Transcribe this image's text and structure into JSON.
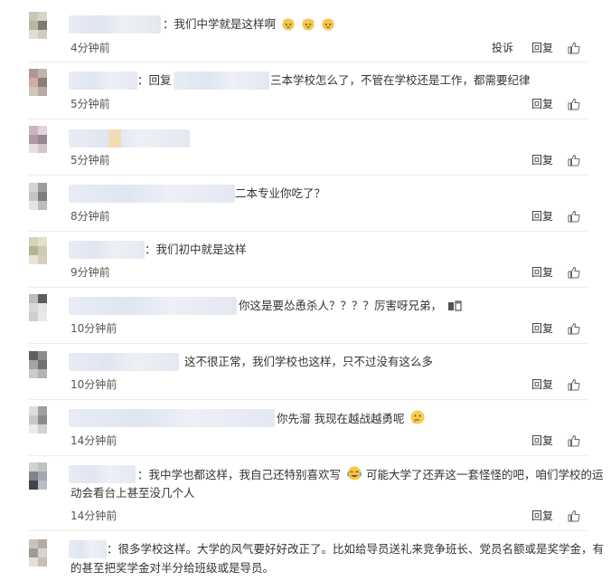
{
  "labels": {
    "report": "投诉",
    "reply": "回复"
  },
  "icons": {
    "like": "thumbs-up-icon",
    "emoji_cat": "cat-face-emoji",
    "emoji_laugh": "laugh-cry-emoji",
    "emoji_think": "thinking-emoji",
    "emoji_beer": "beer-emoji"
  },
  "comments": [
    {
      "text": "：我们中学就是这样啊",
      "time": "4分钟前",
      "emoji": "cat",
      "report": true
    },
    {
      "text": "：回复",
      "text2": "三本学校怎么了，不管在学校还是工作，都需要纪律",
      "time": "5分钟前"
    },
    {
      "text": "",
      "time": "5分钟前"
    },
    {
      "text": "二本专业你吃了？",
      "time": "8分钟前"
    },
    {
      "text": "：我们初中就是这样",
      "time": "9分钟前"
    },
    {
      "text": "你这是要怂恿杀人？？？？厉害呀兄弟，",
      "time": "10分钟前"
    },
    {
      "text": "这不很正常，我们学校也这样，只不过没有这么多",
      "time": "10分钟前"
    },
    {
      "text": "你先溜 我现在越战越勇呢",
      "time": "14分钟前"
    },
    {
      "text": "：我中学也都这样，我自己还特别喜欢写",
      "text2": "可能大学了还弄这一套怪怪的吧，咱们学校的运",
      "text3": "动会看台上甚至没几个人",
      "time": "14分钟前"
    },
    {
      "text": "：很多学校这样。大学的风气要好好改正了。比如给导员送礼来竞争班长、党员名额或是奖学金，有",
      "text2": "的甚至把奖学金对半分给班级或是导员。"
    }
  ]
}
